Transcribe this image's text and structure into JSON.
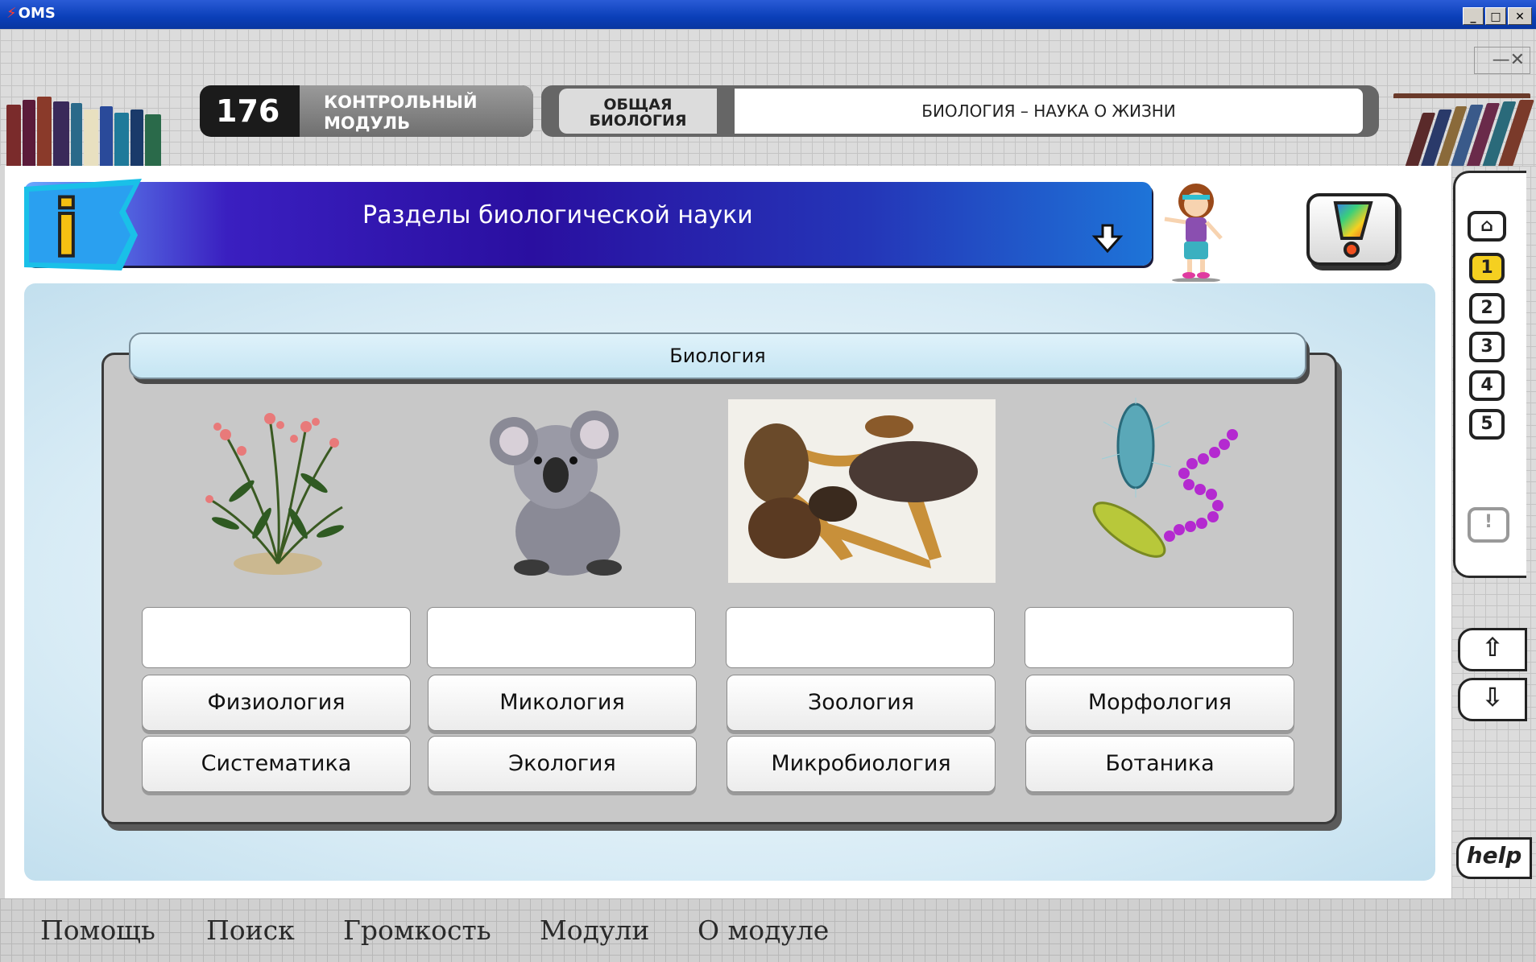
{
  "window": {
    "app_name": "OMS",
    "minimize": "_",
    "maximize": "□",
    "close": "✕"
  },
  "header": {
    "module_number": "176",
    "module_label": "КОНТРОЛЬНЫЙ МОДУЛЬ",
    "course_name": "ОБЩАЯ БИОЛОГИЯ",
    "lesson_title": "БИОЛОГИЯ – НАУКА О ЖИЗНИ"
  },
  "banner": {
    "title": "Разделы биологической науки"
  },
  "panel": {
    "title": "Биология"
  },
  "images": [
    "flower-icon",
    "koala-icon",
    "mushrooms-icon",
    "bacteria-icon"
  ],
  "answer_slots": [
    "",
    "",
    "",
    ""
  ],
  "terms": {
    "row1": [
      "Физиология",
      "Микология",
      "Зоология",
      "Морфология"
    ],
    "row2": [
      "Систематика",
      "Экология",
      "Микробиология",
      "Ботаника"
    ]
  },
  "sidebar": {
    "buttons": [
      "home-icon",
      "1",
      "2",
      "3",
      "4",
      "5"
    ],
    "help_label": "help"
  },
  "menu": [
    "Помощь",
    "Поиск",
    "Громкость",
    "Модули",
    "О модуле"
  ],
  "colors": {
    "banner": "#2a0fa0",
    "title_bar": "#0a3fb8",
    "panel": "#c8c8c8"
  }
}
